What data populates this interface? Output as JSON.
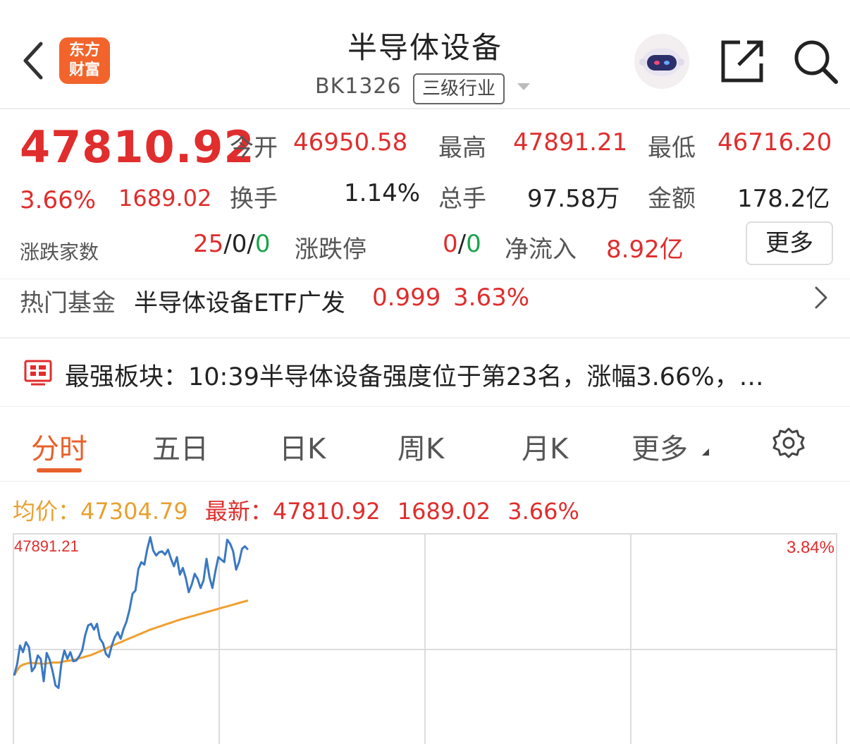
{
  "header": {
    "app_logo": {
      "line1": "东方",
      "line2": "财富"
    },
    "title": "半导体设备",
    "code": "BK1326",
    "tag": "三级行业",
    "icons": [
      "back-icon",
      "robot-avatar-icon",
      "share-icon",
      "search-icon"
    ]
  },
  "quote": {
    "price": "47810.92",
    "pct": "3.66%",
    "change": "1689.02",
    "open_label": "今开",
    "open": "46950.58",
    "high_label": "最高",
    "high": "47891.21",
    "low_label": "最低",
    "low": "46716.20",
    "turnover_label": "换手",
    "turnover": "1.14%",
    "volume_label": "总手",
    "volume": "97.58万",
    "amount_label": "金额",
    "amount": "178.2亿",
    "updown_label": "涨跌家数",
    "up_count": "25",
    "flat_count": "0",
    "down_count": "0",
    "limit_label": "涨跌停",
    "limit_up": "0",
    "limit_down": "0",
    "netflow_label": "净流入",
    "netflow": "8.92亿",
    "more_label": "更多"
  },
  "fund": {
    "label": "热门基金",
    "name": "半导体设备ETF广发",
    "price": "0.999",
    "pct": "3.63%"
  },
  "news": {
    "text": "最强板块：10:39半导体设备强度位于第23名，涨幅3.66%，…"
  },
  "tabs": {
    "items": [
      "分时",
      "五日",
      "日K",
      "周K",
      "月K",
      "更多"
    ],
    "active": "分时"
  },
  "intraday": {
    "avg_label": "均价：",
    "avg": "47304.79",
    "latest_label": "最新：",
    "latest": "47810.92",
    "latest_change": "1689.02",
    "latest_pct": "3.66%"
  },
  "chart_data": {
    "type": "line",
    "y_top_label": "47891.21",
    "pct_top_label": "3.84%",
    "ylim": [
      46080,
      47891.21
    ],
    "grid": true,
    "series": [
      {
        "name": "最新",
        "color": "#3a78c3",
        "values": [
          46200,
          46330,
          46560,
          46480,
          46600,
          46540,
          46250,
          46300,
          46440,
          46400,
          46130,
          46470,
          46390,
          46250,
          46080,
          46050,
          46350,
          46500,
          46400,
          46480,
          46370,
          46380,
          46430,
          46500,
          46680,
          46800,
          46820,
          46750,
          46820,
          46640,
          46590,
          46460,
          46420,
          46560,
          46660,
          46720,
          46640,
          46760,
          46850,
          46990,
          47180,
          47220,
          47480,
          47560,
          47530,
          47720,
          47860,
          47700,
          47640,
          47680,
          47690,
          47650,
          47710,
          47600,
          47510,
          47620,
          47410,
          47490,
          47370,
          47200,
          47290,
          47420,
          47360,
          47250,
          47340,
          47600,
          47380,
          47250,
          47450,
          47620,
          47590,
          47560,
          47830,
          47780,
          47690,
          47470,
          47560,
          47720,
          47750,
          47710
        ]
      },
      {
        "name": "均价",
        "color": "#f0a030",
        "values": [
          46200,
          46260,
          46310,
          46330,
          46340,
          46350,
          46350,
          46350,
          46345,
          46345,
          46340,
          46345,
          46350,
          46355,
          46355,
          46355,
          46360,
          46370,
          46375,
          46380,
          46385,
          46395,
          46405,
          46415,
          46425,
          46435,
          46445,
          46460,
          46475,
          46490,
          46505,
          46520,
          46540,
          46555,
          46570,
          46585,
          46600,
          46615,
          46630,
          46645,
          46660,
          46675,
          46690,
          46705,
          46720,
          46735,
          46750,
          46762,
          46774,
          46786,
          46798,
          46810,
          46822,
          46834,
          46846,
          46858,
          46870,
          46880,
          46890,
          46900,
          46910,
          46920,
          46930,
          46940,
          46950,
          46960,
          46970,
          46980,
          46990,
          47000,
          47010,
          47020,
          47030,
          47040,
          47050,
          47060,
          47070,
          47080,
          47090,
          47100
        ]
      }
    ]
  }
}
